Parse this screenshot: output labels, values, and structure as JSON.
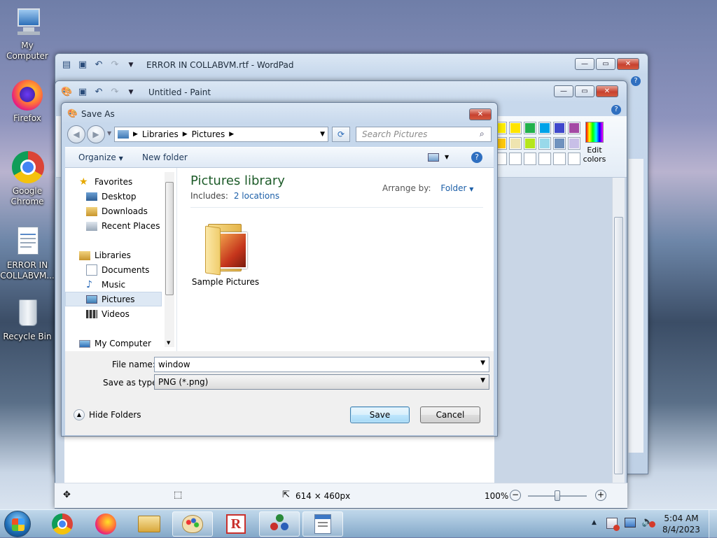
{
  "desktop": {
    "icons": [
      {
        "label": "My Computer"
      },
      {
        "label": "Firefox"
      },
      {
        "label": "Google Chrome"
      },
      {
        "label": "ERROR IN COLLABVM..."
      },
      {
        "label": "Recycle Bin"
      }
    ]
  },
  "wordpad": {
    "title": "ERROR IN COLLABVM.rtf - WordPad"
  },
  "paint": {
    "title": "Untitled - Paint",
    "edit_colors_label": "Edit colors",
    "palette_row1": [
      "#ffee00",
      "#ffe400",
      "#22b14c",
      "#00a2e8",
      "#3f48cc",
      "#a349a4"
    ],
    "palette_row2": [
      "#ffc90e",
      "#efe4b0",
      "#b5e61d",
      "#99d9ea",
      "#7092be",
      "#c8bfe7"
    ],
    "status": {
      "dimensions": "614 × 460px",
      "zoom": "100%"
    }
  },
  "dialog": {
    "title": "Save As",
    "breadcrumb": [
      "Libraries",
      "Pictures"
    ],
    "search_placeholder": "Search Pictures",
    "toolbar": {
      "organize": "Organize",
      "new_folder": "New folder"
    },
    "nav": {
      "favorites": "Favorites",
      "favorites_items": [
        "Desktop",
        "Downloads",
        "Recent Places"
      ],
      "libraries": "Libraries",
      "libraries_items": [
        "Documents",
        "Music",
        "Pictures",
        "Videos"
      ],
      "computer": "My Computer"
    },
    "library": {
      "heading": "Pictures library",
      "includes_label": "Includes:",
      "includes_link": "2 locations",
      "arrange_label": "Arrange by:",
      "arrange_value": "Folder"
    },
    "items": [
      {
        "label": "Sample Pictures"
      }
    ],
    "file_name_label": "File name:",
    "file_name_value": "window",
    "save_type_label": "Save as type:",
    "save_type_value": "PNG (*.png)",
    "hide_folders": "Hide Folders",
    "save_button": "Save",
    "cancel_button": "Cancel"
  },
  "taskbar": {
    "time": "5:04 AM",
    "date": "8/4/2023"
  }
}
